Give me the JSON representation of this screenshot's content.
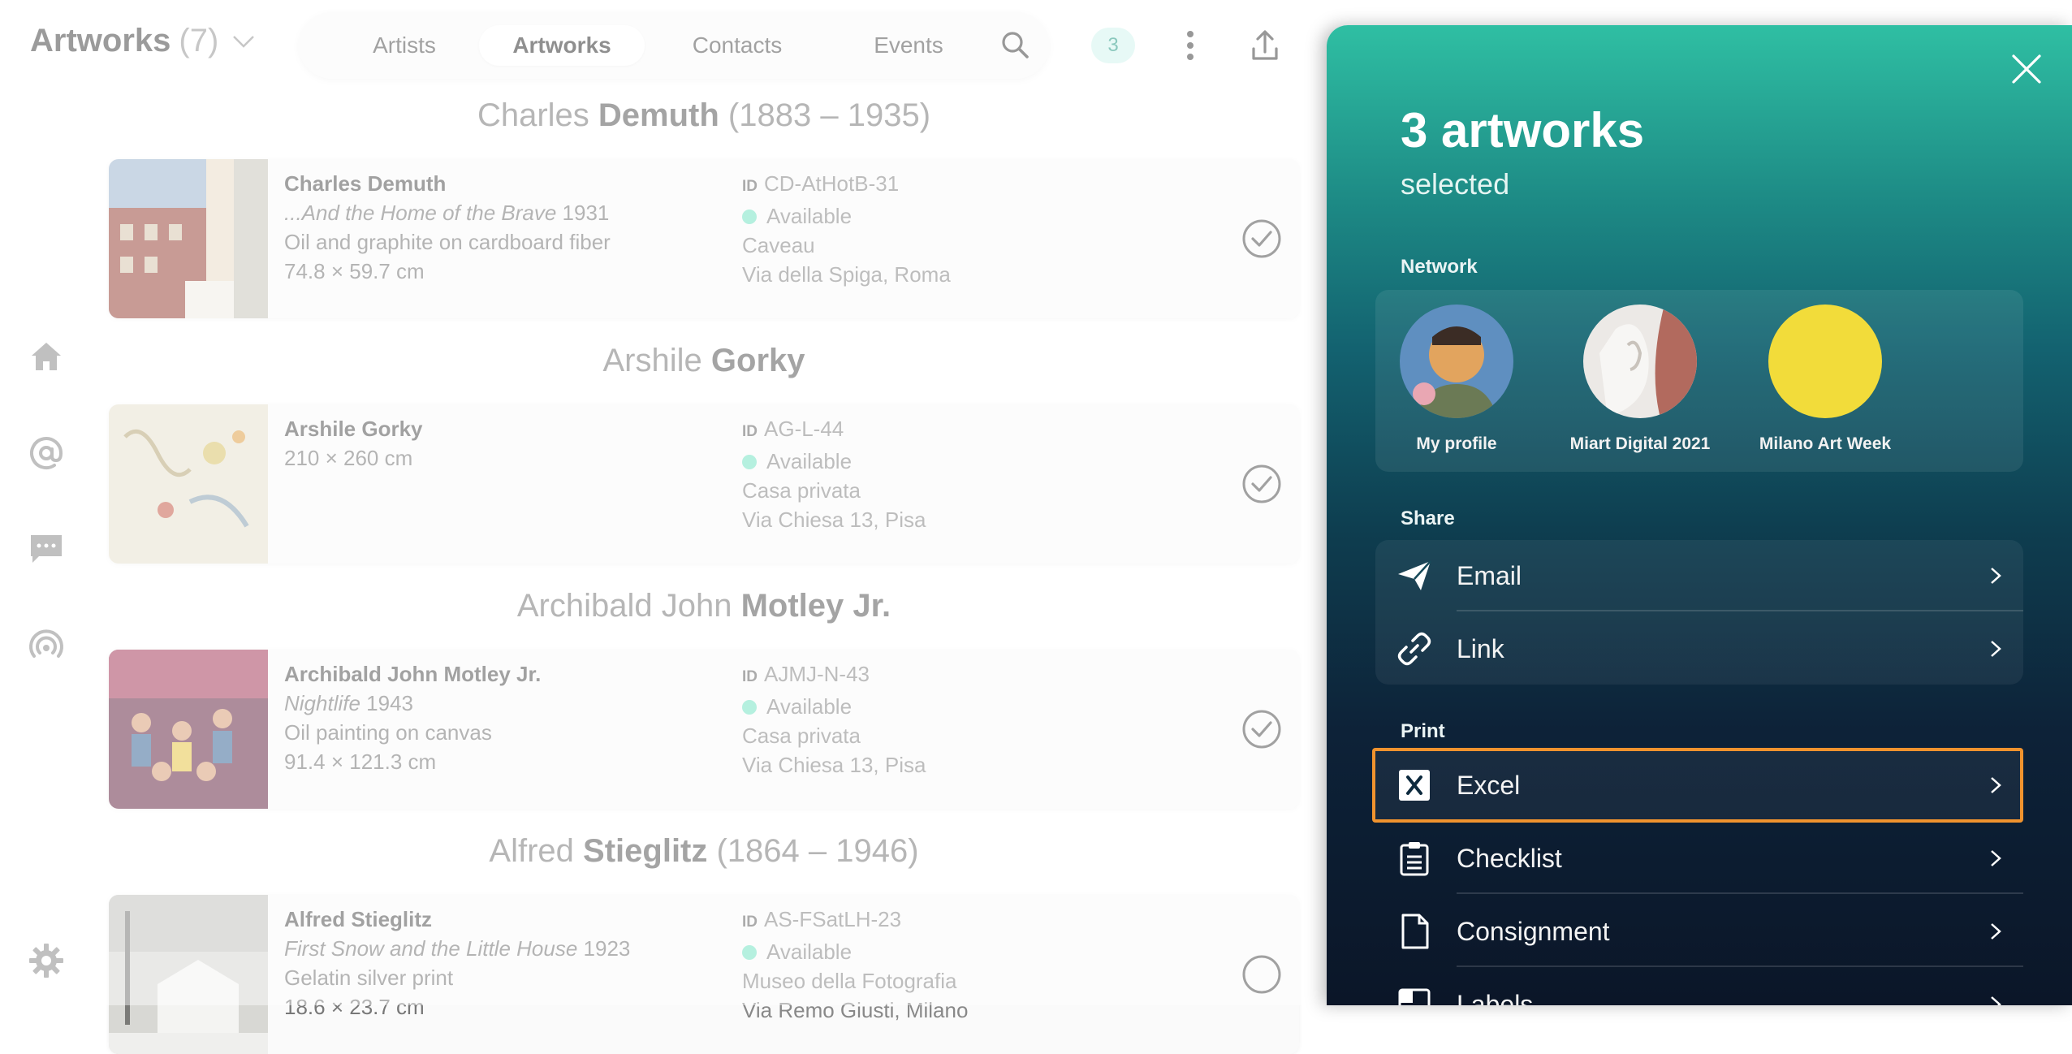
{
  "header": {
    "title": "Artworks",
    "count": "(7)",
    "tabs": [
      "Artists",
      "Artworks",
      "Contacts",
      "Events"
    ],
    "active_tab": "Artworks",
    "selected_badge": "3"
  },
  "groups": [
    {
      "heading_first": "Charles ",
      "heading_last": "Demuth",
      "heading_dates": " (1883 – 1935)",
      "artist": "Charles Demuth",
      "title": "...And the Home of the Brave",
      "year": " 1931",
      "medium": "Oil and graphite on cardboard fiber",
      "size": "74.8 × 59.7 cm",
      "id_label": "ID",
      "id": "CD-AtHotB-31",
      "status": "Available",
      "location": "Caveau",
      "address": "Via della Spiga, Roma",
      "selected": true
    },
    {
      "heading_first": "Arshile ",
      "heading_last": "Gorky",
      "heading_dates": "",
      "artist": "Arshile Gorky",
      "title": "",
      "year": "",
      "medium": "210 × 260 cm",
      "size": "",
      "id_label": "ID",
      "id": "AG-L-44",
      "status": "Available",
      "location": "Casa privata",
      "address": "Via Chiesa 13, Pisa",
      "selected": true
    },
    {
      "heading_first": "Archibald John ",
      "heading_last": "Motley Jr.",
      "heading_dates": "",
      "artist": "Archibald John Motley Jr.",
      "title": "Nightlife",
      "year": " 1943",
      "medium": "Oil painting on canvas",
      "size": "91.4 × 121.3 cm",
      "id_label": "ID",
      "id": "AJMJ-N-43",
      "status": "Available",
      "location": "Casa privata",
      "address": "Via Chiesa 13, Pisa",
      "selected": true
    },
    {
      "heading_first": "Alfred ",
      "heading_last": "Stieglitz",
      "heading_dates": " (1864 – 1946)",
      "artist": "Alfred Stieglitz",
      "title": "First Snow and the Little House",
      "year": " 1923",
      "medium": "Gelatin silver print",
      "size": "18.6 × 23.7 cm",
      "id_label": "ID",
      "id": "AS-FSatLH-23",
      "status": "Available",
      "location": "Museo della Fotografia",
      "address": "Via Remo Giusti, Milano",
      "selected": false
    }
  ],
  "panel": {
    "title": "3 artworks",
    "subtitle": "selected",
    "network_label": "Network",
    "network": [
      "My profile",
      "Miart Digital 2021",
      "Milano Art Week"
    ],
    "share_label": "Share",
    "share": [
      "Email",
      "Link"
    ],
    "print_label": "Print",
    "print": [
      "Excel",
      "Checklist",
      "Consignment",
      "Labels"
    ]
  },
  "colors": {
    "accent": "#2fbfa3",
    "available_dot": "#79e3c5",
    "highlight": "#f0932e",
    "badge_bg": "#d4f5ee"
  }
}
